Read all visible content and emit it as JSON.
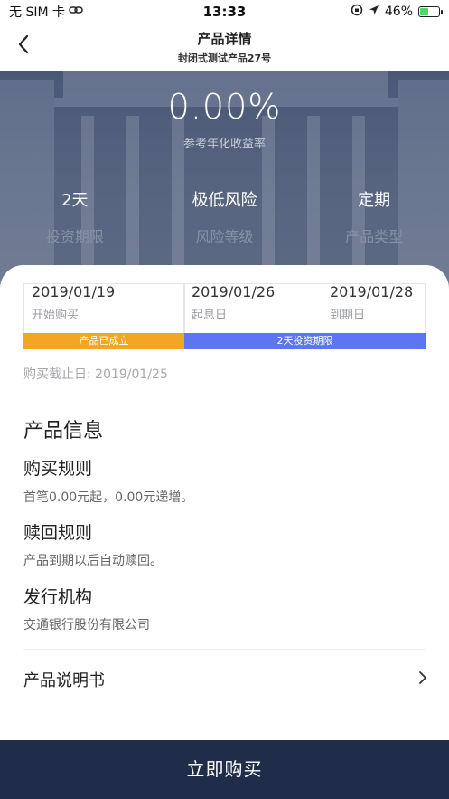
{
  "status_bar": {
    "carrier": "无 SIM 卡",
    "time": "13:33",
    "battery_percent": "46%",
    "battery_level": 0.46
  },
  "nav": {
    "title": "产品详情",
    "subtitle": "封闭式测试产品27号"
  },
  "hero": {
    "rate": "0.00%",
    "rate_label": "参考年化收益率",
    "stats": [
      {
        "value": "2天",
        "label": "投资期限"
      },
      {
        "value": "极低风险",
        "label": "风险等级"
      },
      {
        "value": "定期",
        "label": "产品类型"
      }
    ]
  },
  "timeline": {
    "points": [
      {
        "date": "2019/01/19",
        "label": "开始购买"
      },
      {
        "date": "2019/01/26",
        "label": "起息日"
      },
      {
        "date": "2019/01/28",
        "label": "到期日"
      }
    ],
    "bars": {
      "established": "产品已成立",
      "period": "2天投资期限"
    }
  },
  "deadline": "购买截止日: 2019/01/25",
  "info": {
    "title": "产品信息",
    "sections": [
      {
        "title": "购买规则",
        "text": "首笔0.00元起，0.00元递增。"
      },
      {
        "title": "赎回规则",
        "text": "产品到期以后自动赎回。"
      },
      {
        "title": "发行机构",
        "text": "交通银行股份有限公司"
      }
    ]
  },
  "prospectus": "产品说明书",
  "buy_button": "立即购买",
  "colors": {
    "hero_bg": "#4a5878",
    "orange_bar": "#f2a623",
    "blue_bar": "#5b76f0",
    "buy_bg": "#1f2c4a"
  },
  "icons": [
    "link-icon",
    "location-icon",
    "orientation-lock-icon",
    "battery-icon",
    "back-arrow-icon",
    "chevron-right-icon"
  ]
}
